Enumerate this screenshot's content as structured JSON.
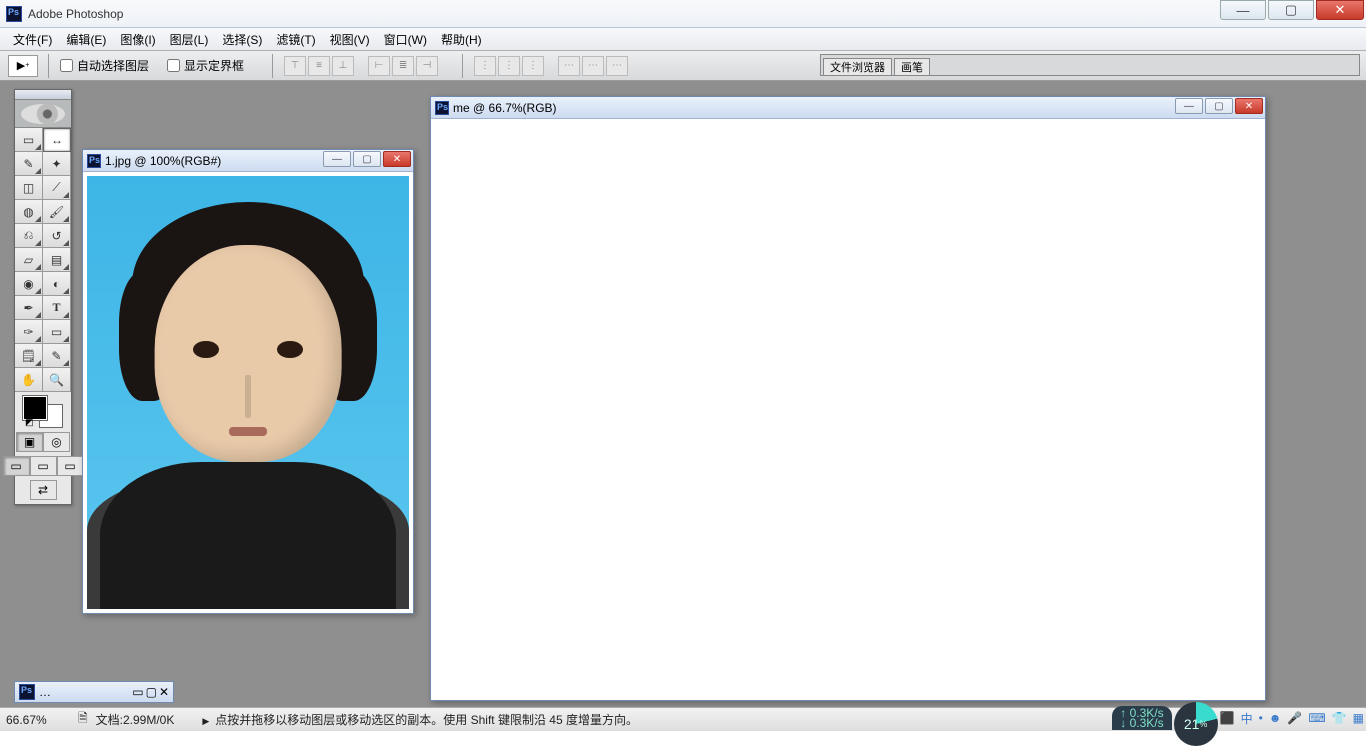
{
  "titlebar": {
    "app_name": "Adobe Photoshop"
  },
  "menu": {
    "file": "文件(F)",
    "edit": "编辑(E)",
    "image": "图像(I)",
    "layer": "图层(L)",
    "select": "选择(S)",
    "filter": "滤镜(T)",
    "view": "视图(V)",
    "window": "窗口(W)",
    "help": "帮助(H)"
  },
  "options": {
    "auto_select_layer": "自动选择图层",
    "show_bounding_box": "显示定界框",
    "palette_tab1": "文件浏览器",
    "palette_tab2": "画笔"
  },
  "doc1": {
    "title": "1.jpg @ 100%(RGB#)"
  },
  "doc2": {
    "title": "me @ 66.7%(RGB)"
  },
  "minidoc": {
    "label": "…"
  },
  "status": {
    "zoom": "66.67%",
    "docinfo": "文档:2.99M/0K",
    "hint": "点按并拖移以移动图层或移动选区的副本。使用 Shift 键限制沿 45 度增量方向。"
  },
  "tools": {
    "marquee": "▭",
    "move": "↔",
    "lasso": "✎",
    "wand": "✦",
    "crop": "◫",
    "slice": "⟋",
    "heal": "◍",
    "brush": "🖌",
    "stamp": "⎌",
    "history": "↺",
    "eraser": "▱",
    "grad": "▤",
    "blur": "◉",
    "dodge": "◐",
    "path": "✒",
    "type": "T",
    "pen": "✑",
    "shape": "▭",
    "notes": "🗒",
    "eyedrop": "✎",
    "hand": "✋",
    "zoom": "🔍"
  },
  "tray": {
    "net_up": "0.3K/s",
    "net_dn": "0.3K/s",
    "cpu": "21",
    "cpu_pct": "%"
  }
}
